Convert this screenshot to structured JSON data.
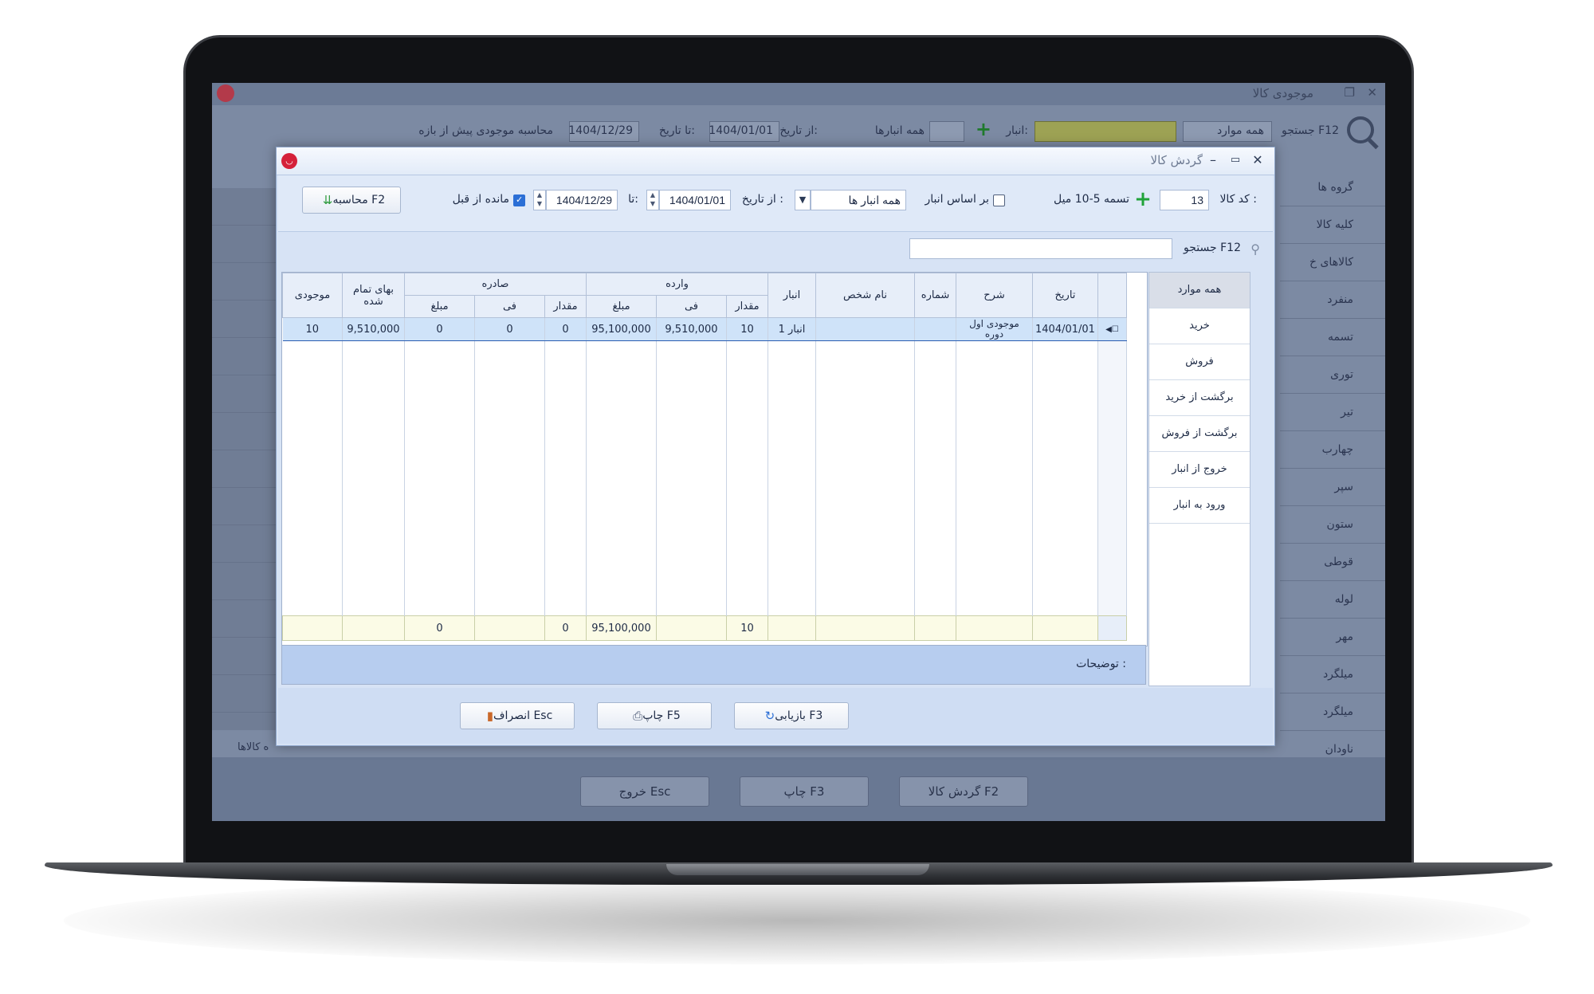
{
  "background_window": {
    "title": "موجودی کالا",
    "toolbar": {
      "search_label": "جستجو F12",
      "all_items": "همه موارد",
      "warehouse_label": "انبار:",
      "all_warehouses": "همه انبارها",
      "from_date_label": "از تاریخ:",
      "from_date": "1404/01/01",
      "to_date_label": "تا تاریخ:",
      "to_date": "1404/12/29",
      "calc_prev_label": "محاسبه موجودی پیش از بازه"
    },
    "right_list": [
      "گروه ها",
      "کلیه کالا",
      "کالاهای خ",
      "منفرد",
      "تسمه",
      "توری",
      "تیر",
      "چهارب",
      "سپر",
      "ستون",
      "قوطی",
      "لوله",
      "مهر",
      "میلگرد",
      "میلگرد",
      "ناودان"
    ],
    "footer_label": "ه کالاها",
    "buttons": {
      "turnover": "گردش کالا F2",
      "print": "چاپ F3",
      "exit": "خروج Esc"
    }
  },
  "dialog": {
    "title": "گردش کالا",
    "code_label": "کد کالا :",
    "code_value": "13",
    "product_name": "تسمه 5-10 میل",
    "by_warehouse_label": "بر اساس انبار",
    "warehouse_value": "همه انبار ها",
    "from_date_label": "از تاریخ :",
    "from_date": "1404/01/01",
    "to_label": "تا:",
    "to_date": "1404/12/29",
    "prev_balance_label": "مانده از قبل",
    "calc_button": "محاسبه F2",
    "search_label": "جستجو F12",
    "search_value": "",
    "table": {
      "group_incoming": "وارده",
      "group_outgoing": "صادره",
      "col_date": "تاریخ",
      "col_desc": "شرح",
      "col_number": "شماره",
      "col_person": "نام شخص",
      "col_warehouse": "انبار",
      "col_qty": "مقدار",
      "col_fee": "فی",
      "col_amount": "مبلغ",
      "col_cost": "بهای تمام شده",
      "col_stock": "موجودی",
      "row": {
        "date": "1404/01/01",
        "desc": "موجودی اول دوره",
        "number": "",
        "person": "",
        "warehouse": "انبار 1",
        "in_qty": "10",
        "in_fee": "9,510,000",
        "in_amount": "95,100,000",
        "out_qty": "0",
        "out_fee": "0",
        "out_amount": "0",
        "cost": "9,510,000",
        "stock": "10"
      },
      "totals": {
        "in_qty": "10",
        "in_amount": "95,100,000",
        "out_qty": "0",
        "out_amount": "0"
      }
    },
    "description_label": "توضیحات :",
    "filters": [
      "همه موارد",
      "خرید",
      "فروش",
      "برگشت از خرید",
      "برگشت از فروش",
      "خروج از انبار",
      "ورود به انبار"
    ],
    "buttons": {
      "refresh": "بازیابی F3",
      "print": "چاپ F5",
      "cancel": "انصراف Esc"
    }
  },
  "colors": {
    "dialog_bg": "#d7e3f5",
    "selected_row": "#cfe3f9",
    "footer_row": "#fbfbe6",
    "logo_red": "#d5213a"
  }
}
